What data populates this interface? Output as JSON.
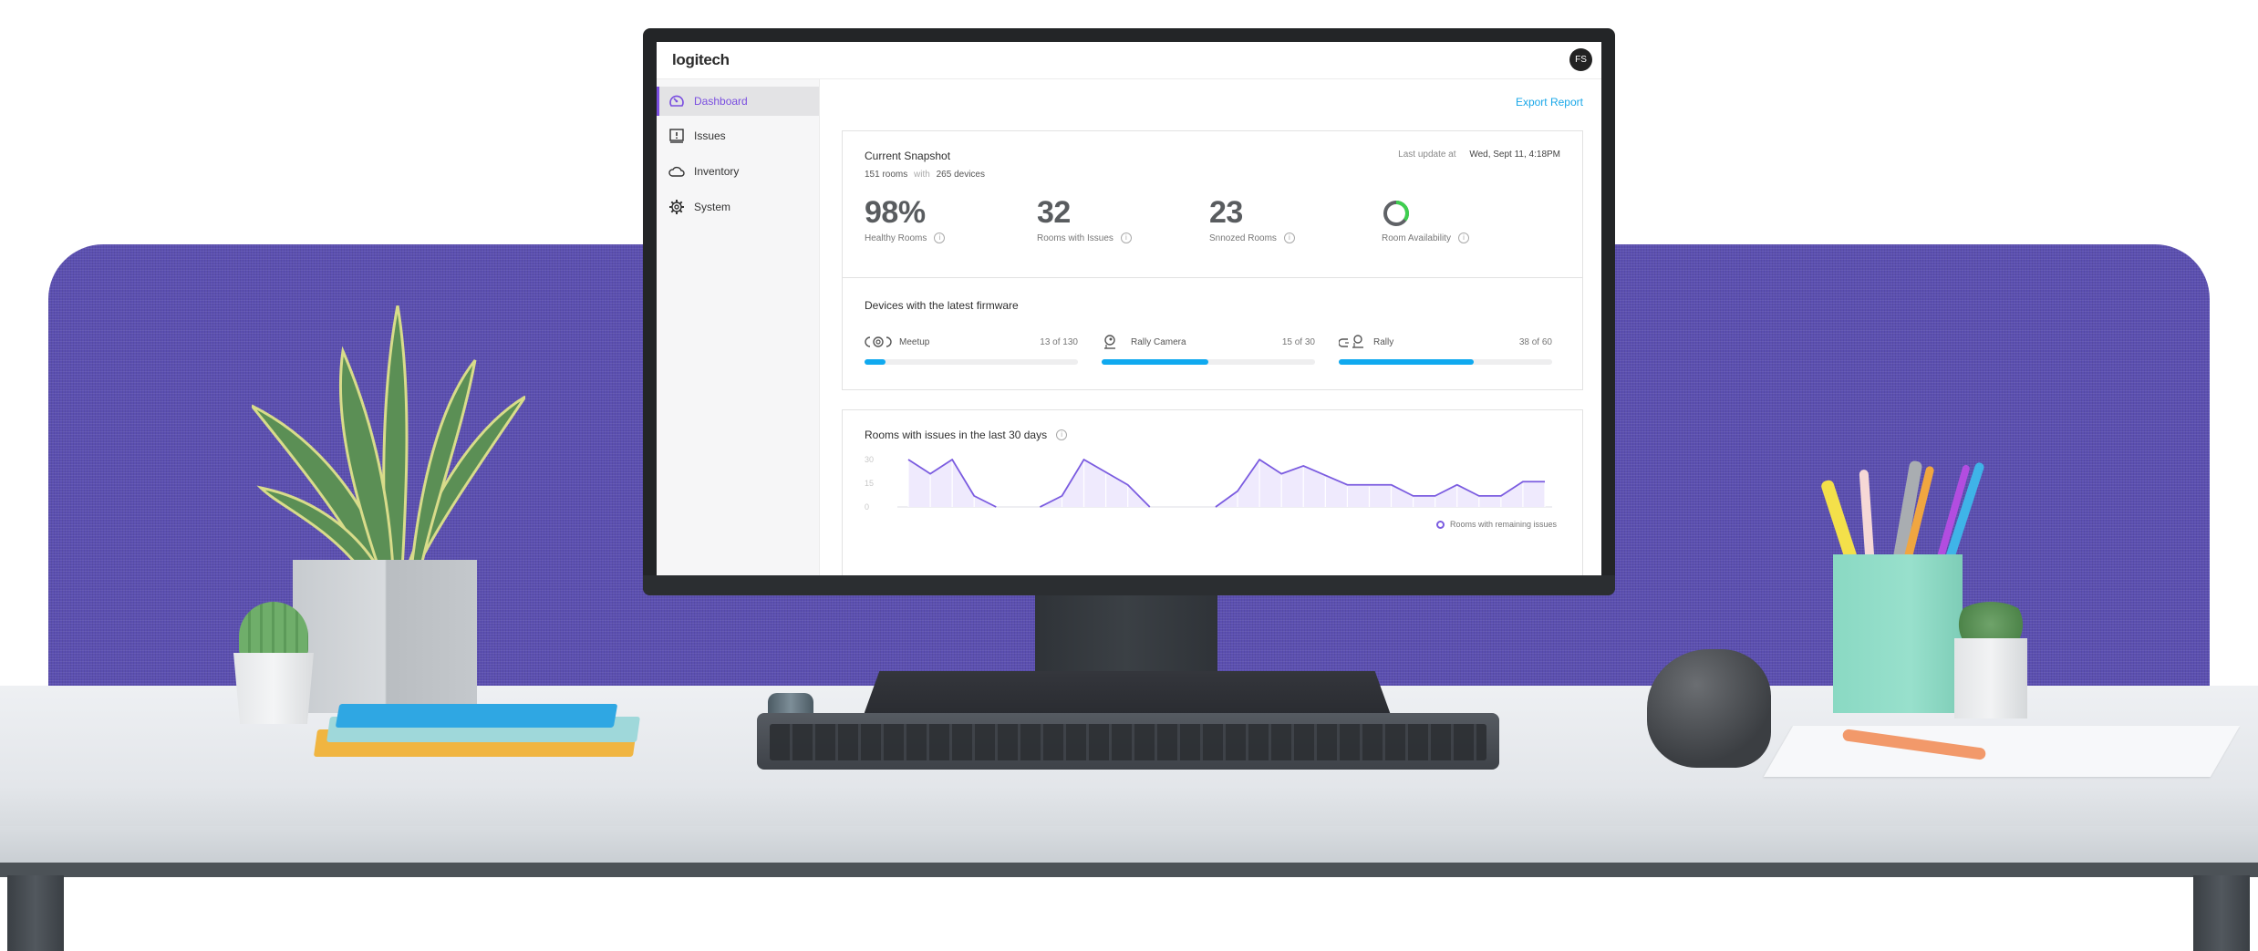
{
  "app": {
    "logo": "logitech",
    "user_initials": "FS"
  },
  "sidebar": {
    "items": [
      {
        "label": "Dashboard",
        "icon": "dashboard-gauge-icon",
        "active": true
      },
      {
        "label": "Issues",
        "icon": "issues-alert-icon",
        "active": false
      },
      {
        "label": "Inventory",
        "icon": "cloud-icon",
        "active": false
      },
      {
        "label": "System",
        "icon": "gear-icon",
        "active": false
      }
    ]
  },
  "main": {
    "export_label": "Export Report",
    "snapshot": {
      "title": "Current Snapshot",
      "rooms_count": "151 rooms",
      "with_word": "with",
      "devices_count": "265 devices",
      "last_update_label": "Last update at",
      "last_update_value": "Wed, Sept 11, 4:18PM",
      "stats": [
        {
          "value": "98%",
          "label": "Healthy Rooms"
        },
        {
          "value": "32",
          "label": "Rooms with Issues"
        },
        {
          "value": "23",
          "label": "Snnozed Rooms"
        },
        {
          "value": "",
          "label": "Room Availability",
          "donut_fraction": 0.35,
          "donut_color": "#3ecf4f",
          "donut_track": "#5f6266"
        }
      ]
    },
    "firmware": {
      "title": "Devices with the latest firmware",
      "devices": [
        {
          "name": "Meetup",
          "icon": "meetup-device-icon",
          "count_text": "13 of 130",
          "done": 13,
          "total": 130
        },
        {
          "name": "Rally Camera",
          "icon": "rally-camera-icon",
          "count_text": "15 of 30",
          "done": 15,
          "total": 30
        },
        {
          "name": "Rally",
          "icon": "rally-system-icon",
          "count_text": "38 of 60",
          "done": 38,
          "total": 60
        }
      ],
      "bar_color": "#10a9ef"
    }
  },
  "chart_data": {
    "type": "area",
    "title": "Rooms with issues in the last 30 days",
    "xlabel": "",
    "ylabel": "",
    "ylim": [
      0,
      30
    ],
    "yticks": [
      "30",
      "15",
      "0"
    ],
    "grid": false,
    "legend": {
      "position": "bottom-right",
      "entries": [
        "Rooms with remaining issues"
      ]
    },
    "line_color": "#7b5ce0",
    "fill_color": "#efeafd",
    "series": [
      {
        "name": "Rooms with remaining issues",
        "values": [
          30,
          21,
          30,
          7,
          0,
          null,
          0,
          7,
          30,
          22,
          14,
          0,
          null,
          null,
          0,
          10,
          30,
          21,
          26,
          20,
          14,
          14,
          14,
          7,
          7,
          14,
          7,
          7,
          16,
          16
        ]
      }
    ]
  }
}
